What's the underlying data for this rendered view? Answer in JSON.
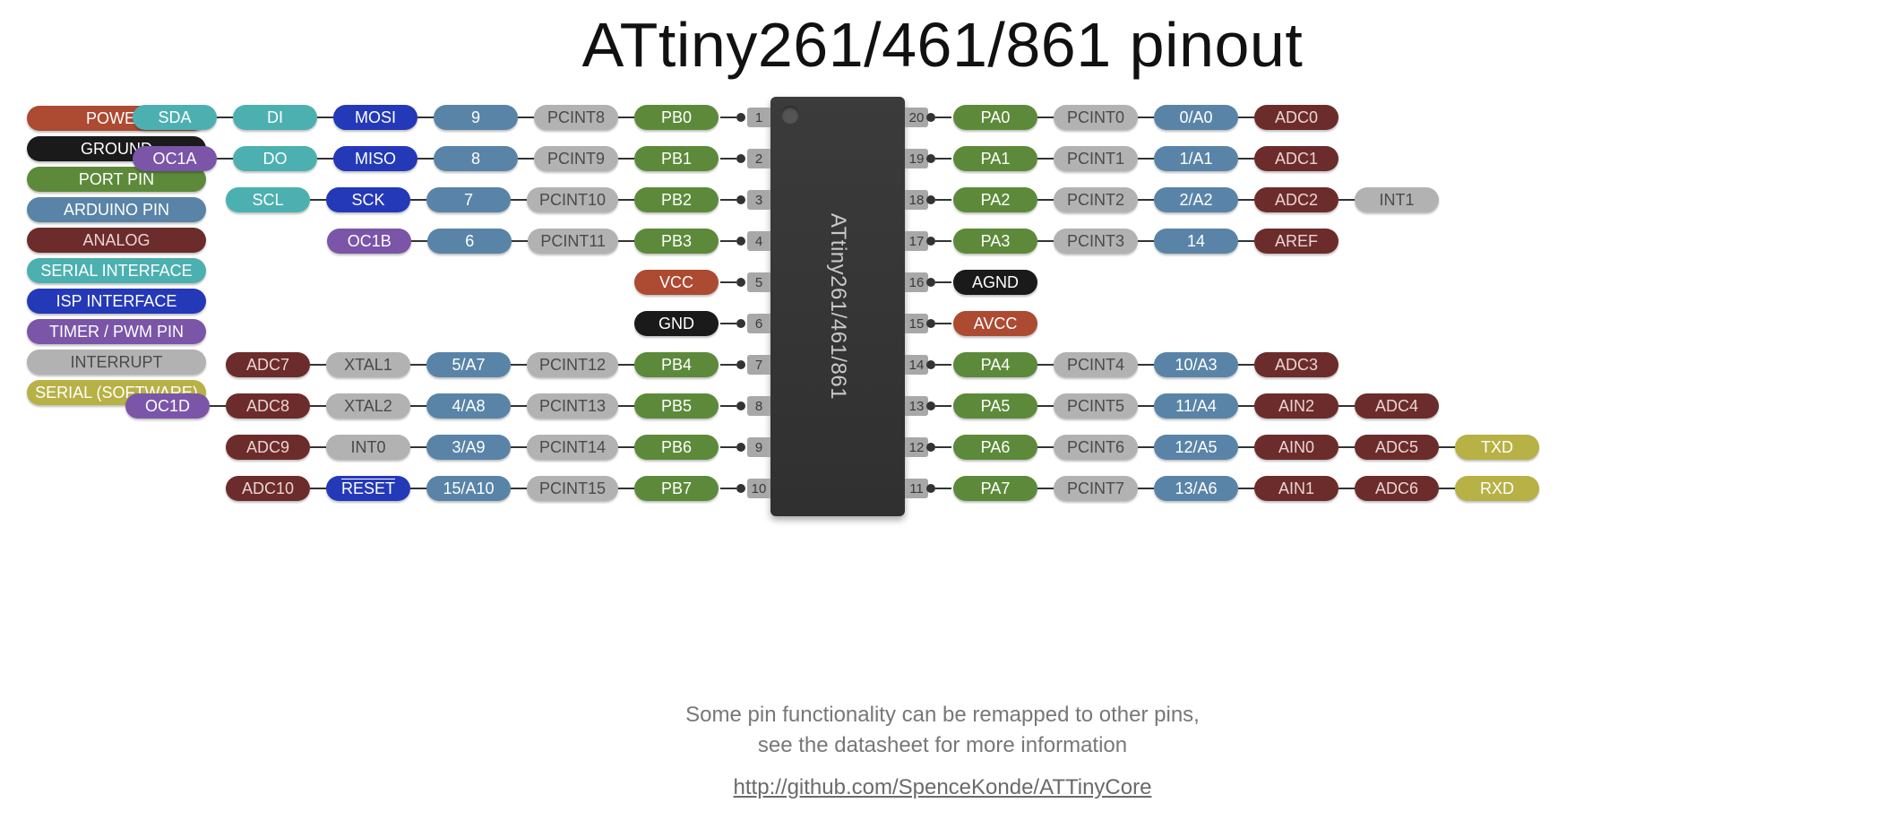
{
  "title": "ATtiny261/461/861 pinout",
  "chip_label": "ATtiny261/461/861",
  "footer": {
    "line1": "Some pin functionality can be remapped to other pins,",
    "line2": "see the datasheet for more information",
    "link": "http://github.com/SpenceKonde/ATTinyCore"
  },
  "legend": [
    {
      "label": "POWER",
      "cls": "c-power"
    },
    {
      "label": "GROUND",
      "cls": "c-ground"
    },
    {
      "label": "PORT PIN",
      "cls": "c-port"
    },
    {
      "label": "ARDUINO PIN",
      "cls": "c-arduino"
    },
    {
      "label": "ANALOG",
      "cls": "c-analog"
    },
    {
      "label": "SERIAL INTERFACE",
      "cls": "c-serial"
    },
    {
      "label": "ISP INTERFACE",
      "cls": "c-isp"
    },
    {
      "label": "TIMER / PWM PIN",
      "cls": "c-timer"
    },
    {
      "label": "INTERRUPT",
      "cls": "c-int"
    },
    {
      "label": "SERIAL (SOFTWARE)",
      "cls": "c-sw"
    }
  ],
  "colors": {
    "power": "#ad4a32",
    "ground": "#1a1a1a",
    "port": "#5d8a3a",
    "arduino": "#5984a8",
    "analog": "#6c2c2b",
    "serial": "#4db0b0",
    "isp": "#2439b8",
    "timer": "#7a55a8",
    "int": "#b2b2b2",
    "sw": "#b7b146"
  },
  "chip": {
    "pins_per_side": 10,
    "left_numbers": [
      "1",
      "2",
      "3",
      "4",
      "5",
      "6",
      "7",
      "8",
      "9",
      "10"
    ],
    "right_numbers": [
      "20",
      "19",
      "18",
      "17",
      "16",
      "15",
      "14",
      "13",
      "12",
      "11"
    ]
  },
  "rows": {
    "left": [
      [
        {
          "t": "SDA",
          "c": "c-serial"
        },
        {
          "t": "DI",
          "c": "c-serial"
        },
        {
          "t": "MOSI",
          "c": "c-isp"
        },
        {
          "t": "9",
          "c": "c-arduino"
        },
        {
          "t": "PCINT8",
          "c": "c-int"
        },
        {
          "t": "PB0",
          "c": "c-port"
        }
      ],
      [
        {
          "t": "OC1A",
          "c": "c-timer"
        },
        {
          "t": "DO",
          "c": "c-serial"
        },
        {
          "t": "MISO",
          "c": "c-isp"
        },
        {
          "t": "8",
          "c": "c-arduino"
        },
        {
          "t": "PCINT9",
          "c": "c-int"
        },
        {
          "t": "PB1",
          "c": "c-port"
        }
      ],
      [
        {
          "t": "SCL",
          "c": "c-serial"
        },
        {
          "t": "SCK",
          "c": "c-isp"
        },
        {
          "t": "7",
          "c": "c-arduino"
        },
        {
          "t": "PCINT10",
          "c": "c-int"
        },
        {
          "t": "PB2",
          "c": "c-port"
        }
      ],
      [
        {
          "t": "OC1B",
          "c": "c-timer"
        },
        {
          "t": "6",
          "c": "c-arduino"
        },
        {
          "t": "PCINT11",
          "c": "c-int"
        },
        {
          "t": "PB3",
          "c": "c-port"
        }
      ],
      [
        {
          "t": "VCC",
          "c": "c-power"
        }
      ],
      [
        {
          "t": "GND",
          "c": "c-ground"
        }
      ],
      [
        {
          "t": "ADC7",
          "c": "c-analog"
        },
        {
          "t": "XTAL1",
          "c": "c-int"
        },
        {
          "t": "5/A7",
          "c": "c-arduino"
        },
        {
          "t": "PCINT12",
          "c": "c-int"
        },
        {
          "t": "PB4",
          "c": "c-port"
        }
      ],
      [
        {
          "t": "OC1D",
          "c": "c-timer"
        },
        {
          "t": "ADC8",
          "c": "c-analog"
        },
        {
          "t": "XTAL2",
          "c": "c-int"
        },
        {
          "t": "4/A8",
          "c": "c-arduino"
        },
        {
          "t": "PCINT13",
          "c": "c-int"
        },
        {
          "t": "PB5",
          "c": "c-port"
        }
      ],
      [
        {
          "t": "ADC9",
          "c": "c-analog"
        },
        {
          "t": "INT0",
          "c": "c-int"
        },
        {
          "t": "3/A9",
          "c": "c-arduino"
        },
        {
          "t": "PCINT14",
          "c": "c-int"
        },
        {
          "t": "PB6",
          "c": "c-port"
        }
      ],
      [
        {
          "t": "ADC10",
          "c": "c-analog"
        },
        {
          "t": "RESET",
          "c": "c-isp",
          "ov": true
        },
        {
          "t": "15/A10",
          "c": "c-arduino"
        },
        {
          "t": "PCINT15",
          "c": "c-int"
        },
        {
          "t": "PB7",
          "c": "c-port"
        }
      ]
    ],
    "right": [
      [
        {
          "t": "PA0",
          "c": "c-port"
        },
        {
          "t": "PCINT0",
          "c": "c-int"
        },
        {
          "t": "0/A0",
          "c": "c-arduino"
        },
        {
          "t": "ADC0",
          "c": "c-analog"
        }
      ],
      [
        {
          "t": "PA1",
          "c": "c-port"
        },
        {
          "t": "PCINT1",
          "c": "c-int"
        },
        {
          "t": "1/A1",
          "c": "c-arduino"
        },
        {
          "t": "ADC1",
          "c": "c-analog"
        }
      ],
      [
        {
          "t": "PA2",
          "c": "c-port"
        },
        {
          "t": "PCINT2",
          "c": "c-int"
        },
        {
          "t": "2/A2",
          "c": "c-arduino"
        },
        {
          "t": "ADC2",
          "c": "c-analog"
        },
        {
          "t": "INT1",
          "c": "c-int"
        }
      ],
      [
        {
          "t": "PA3",
          "c": "c-port"
        },
        {
          "t": "PCINT3",
          "c": "c-int"
        },
        {
          "t": "14",
          "c": "c-arduino"
        },
        {
          "t": "AREF",
          "c": "c-analog"
        }
      ],
      [
        {
          "t": "AGND",
          "c": "c-ground"
        }
      ],
      [
        {
          "t": "AVCC",
          "c": "c-power"
        }
      ],
      [
        {
          "t": "PA4",
          "c": "c-port"
        },
        {
          "t": "PCINT4",
          "c": "c-int"
        },
        {
          "t": "10/A3",
          "c": "c-arduino"
        },
        {
          "t": "ADC3",
          "c": "c-analog"
        }
      ],
      [
        {
          "t": "PA5",
          "c": "c-port"
        },
        {
          "t": "PCINT5",
          "c": "c-int"
        },
        {
          "t": "11/A4",
          "c": "c-arduino"
        },
        {
          "t": "AIN2",
          "c": "c-analog"
        },
        {
          "t": "ADC4",
          "c": "c-analog"
        }
      ],
      [
        {
          "t": "PA6",
          "c": "c-port"
        },
        {
          "t": "PCINT6",
          "c": "c-int"
        },
        {
          "t": "12/A5",
          "c": "c-arduino"
        },
        {
          "t": "AIN0",
          "c": "c-analog"
        },
        {
          "t": "ADC5",
          "c": "c-analog"
        },
        {
          "t": "TXD",
          "c": "c-sw"
        }
      ],
      [
        {
          "t": "PA7",
          "c": "c-port"
        },
        {
          "t": "PCINT7",
          "c": "c-int"
        },
        {
          "t": "13/A6",
          "c": "c-arduino"
        },
        {
          "t": "AIN1",
          "c": "c-analog"
        },
        {
          "t": "ADC6",
          "c": "c-analog"
        },
        {
          "t": "RXD",
          "c": "c-sw"
        }
      ]
    ]
  }
}
